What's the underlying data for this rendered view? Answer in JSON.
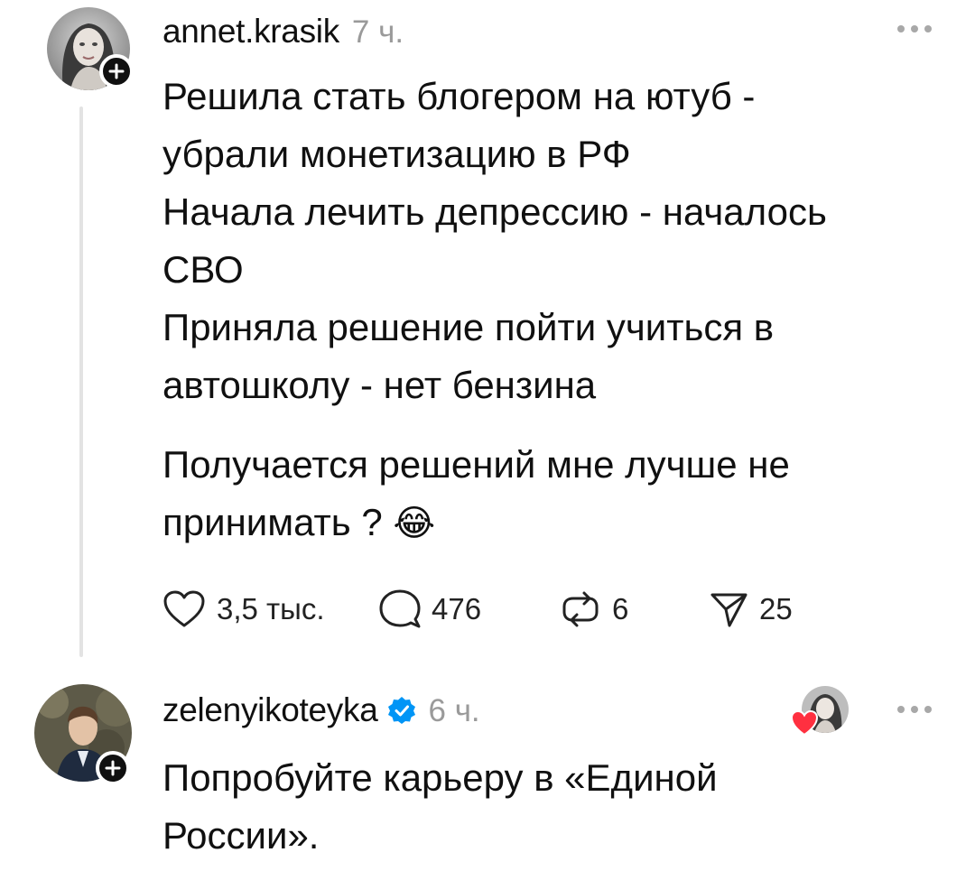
{
  "comments": [
    {
      "username": "annet.krasik",
      "time": "7 ч.",
      "follow_icon": "plus",
      "lines": [
        "Решила стать блогером на ютуб -",
        "убрали монетизацию в РФ",
        "Начала лечить депрессию - началось",
        "СВО",
        "Приняла решение пойти учиться в",
        "автошколу - нет бензина",
        "Получается решений мне лучше не",
        "принимать ?"
      ],
      "emoji": "😂",
      "likes": "3,5 тыс.",
      "replies": "476",
      "reposts": "6",
      "shares": "25"
    },
    {
      "username": "zelenyikoteyka",
      "verified": true,
      "time": "6 ч.",
      "follow_icon": "plus",
      "liked_by_author": true,
      "lines": [
        "Попробуйте карьеру в «Единой",
        "России»."
      ]
    }
  ],
  "colors": {
    "text": "#101010",
    "muted": "#9a9a9a",
    "verified": "#0095f6",
    "heart": "#ff3040",
    "thread_line": "#e3e3e3"
  }
}
